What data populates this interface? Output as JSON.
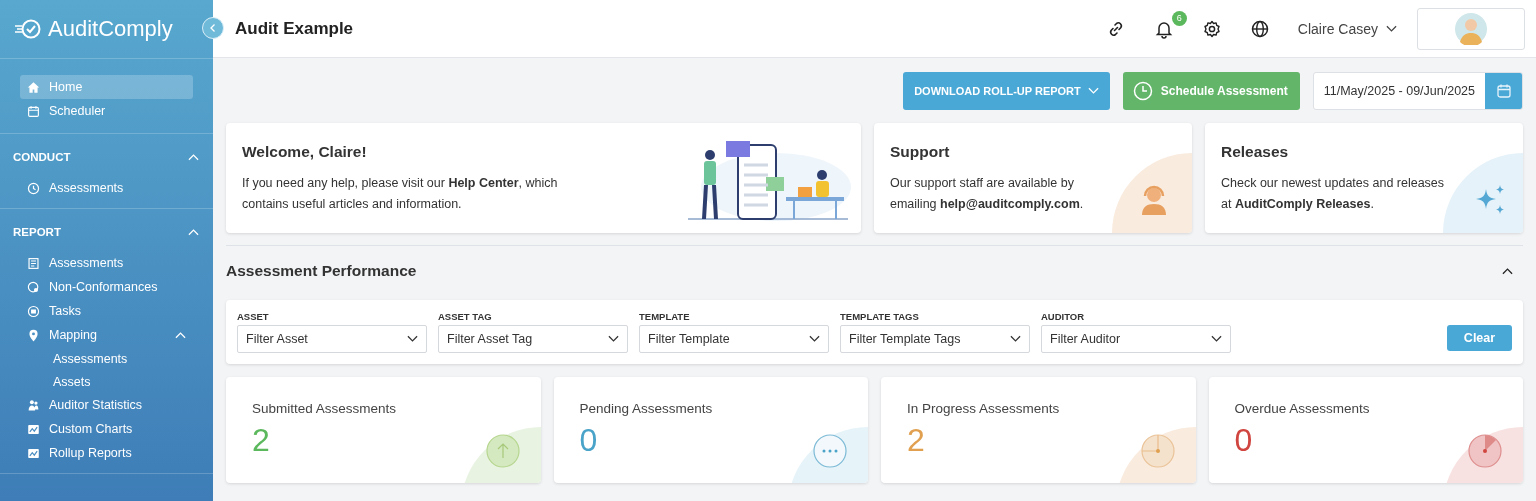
{
  "sidebar": {
    "logo": "AuditComply",
    "items": [
      {
        "label": "Home",
        "kind": "home",
        "selected": true
      },
      {
        "label": "Scheduler",
        "kind": "calendar",
        "selected": false
      }
    ],
    "sections": [
      {
        "title": "CONDUCT",
        "expanded": true,
        "items": [
          {
            "label": "Assessments",
            "kind": "clock",
            "selected": false
          }
        ]
      },
      {
        "title": "REPORT",
        "expanded": true,
        "items": [
          {
            "label": "Assessments",
            "kind": "doc",
            "selected": false
          },
          {
            "label": "Non-Conformances",
            "kind": "badge",
            "selected": false
          },
          {
            "label": "Tasks",
            "kind": "list",
            "selected": false
          },
          {
            "label": "Mapping",
            "kind": "pin",
            "selected": false,
            "expanded": true,
            "children": [
              {
                "label": "Assessments",
                "selected": false
              },
              {
                "label": "Assets",
                "selected": false
              }
            ]
          },
          {
            "label": "Auditor Statistics",
            "kind": "people",
            "selected": false
          },
          {
            "label": "Custom Charts",
            "kind": "chart",
            "selected": false
          },
          {
            "label": "Rollup Reports",
            "kind": "chart",
            "selected": false
          }
        ]
      }
    ]
  },
  "header": {
    "title": "Audit Example",
    "notifications": "6",
    "user": "Claire Casey"
  },
  "toolbar": {
    "download": "DOWNLOAD ROLL-UP REPORT",
    "schedule": "Schedule Assessment",
    "date_range": "11/May/2025 - 09/Jun/2025"
  },
  "welcome": {
    "title": "Welcome, Claire!",
    "text": "If you need any help, please visit our **Help Center**, which contains useful articles and information."
  },
  "support": {
    "title": "Support",
    "text": "Our support staff are available by emailing **help@auditcomply.com**."
  },
  "releases": {
    "title": "Releases",
    "text": "Check our newest updates and releases at **AuditComply Releases**."
  },
  "performance": {
    "title": "Assessment Performance",
    "expanded": true,
    "filters": [
      {
        "label": "ASSET",
        "placeholder": "Filter Asset"
      },
      {
        "label": "ASSET TAG",
        "placeholder": "Filter Asset Tag"
      },
      {
        "label": "TEMPLATE",
        "placeholder": "Filter Template"
      },
      {
        "label": "TEMPLATE TAGS",
        "placeholder": "Filter Template Tags"
      },
      {
        "label": "AUDITOR",
        "placeholder": "Filter Auditor"
      }
    ],
    "clear": "Clear",
    "stats": [
      {
        "label": "Submitted Assessments",
        "value": "2",
        "kind": "submitted",
        "color": "#5cb85c"
      },
      {
        "label": "Pending Assessments",
        "value": "0",
        "kind": "pending",
        "color": "#4aa3c8"
      },
      {
        "label": "In Progress Assessments",
        "value": "2",
        "kind": "progress",
        "color": "#e0a050"
      },
      {
        "label": "Overdue Assessments",
        "value": "0",
        "kind": "overdue",
        "color": "#d0453f"
      }
    ]
  }
}
